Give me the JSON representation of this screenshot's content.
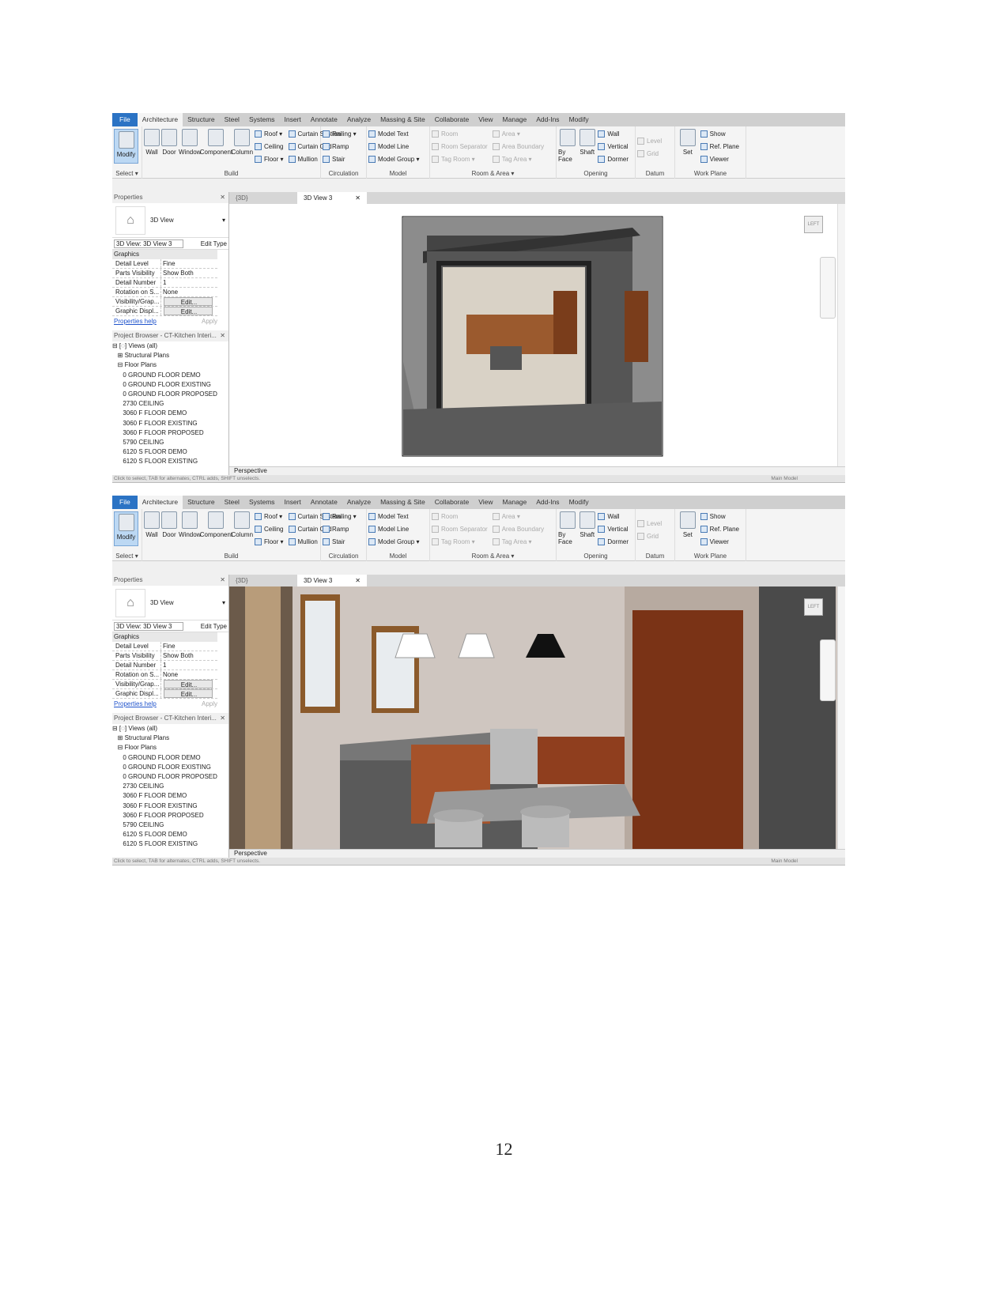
{
  "ribbon": {
    "tabs": [
      "File",
      "Architecture",
      "Structure",
      "Steel",
      "Systems",
      "Insert",
      "Annotate",
      "Analyze",
      "Massing & Site",
      "Collaborate",
      "View",
      "Manage",
      "Add-Ins",
      "Modify"
    ],
    "active_tab": "Architecture",
    "select": {
      "modify": "Modify",
      "label": "Select ▾"
    },
    "build": {
      "label": "Build",
      "big": [
        "Wall",
        "Door",
        "Window",
        "Component",
        "Column"
      ],
      "col1": [
        "Roof ▾",
        "Ceiling",
        "Floor ▾"
      ],
      "col2": [
        "Curtain System",
        "Curtain Grid",
        "Mullion"
      ]
    },
    "circulation": {
      "label": "Circulation",
      "items": [
        "Railing ▾",
        "Ramp",
        "Stair"
      ]
    },
    "model": {
      "label": "Model",
      "items": [
        "Model Text",
        "Model Line",
        "Model Group ▾"
      ]
    },
    "room_area": {
      "label": "Room & Area ▾",
      "col1": [
        "Room",
        "Room Separator",
        "Tag Room ▾"
      ],
      "col2": [
        "Area ▾",
        "Area Boundary",
        "Tag Area ▾"
      ]
    },
    "opening": {
      "label": "Opening",
      "big": [
        "By Face",
        "Shaft"
      ],
      "items": [
        "Wall",
        "Vertical",
        "Dormer"
      ]
    },
    "datum": {
      "label": "Datum",
      "items": [
        "Level",
        "Grid"
      ]
    },
    "work_plane": {
      "label": "Work Plane",
      "big": "Set",
      "items": [
        "Show",
        "Ref. Plane",
        "Viewer"
      ]
    }
  },
  "properties": {
    "title": "Properties",
    "type": "3D View",
    "selector": "3D View: 3D View 3",
    "edit_type": "Edit Type",
    "group": "Graphics",
    "rows": [
      {
        "k": "Detail Level",
        "v": "Fine"
      },
      {
        "k": "Parts Visibility",
        "v": "Show Both"
      },
      {
        "k": "Detail Number",
        "v": "1"
      },
      {
        "k": "Rotation on S...",
        "v": "None"
      },
      {
        "k": "Visibility/Grap...",
        "v": "Edit..."
      },
      {
        "k": "Graphic Displ...",
        "v": "Edit..."
      }
    ],
    "help": "Properties help",
    "apply": "Apply"
  },
  "browser": {
    "title": "Project Browser - CT-Kitchen Interi...",
    "items": [
      "⊟ [◌] Views (all)",
      "   ⊞ Structural Plans",
      "   ⊟ Floor Plans",
      "      0 GROUND FLOOR DEMO",
      "      0 GROUND FLOOR EXISTING",
      "      0 GROUND FLOOR PROPOSED",
      "      2730 CEILING",
      "      3060 F FLOOR DEMO",
      "      3060 F FLOOR EXISTING",
      "      3060 F FLOOR PROPOSED",
      "      5790 CEILING",
      "      6120 S FLOOR DEMO",
      "      6120 S FLOOR EXISTING"
    ]
  },
  "views": {
    "tab1": "{3D}",
    "tab2": "3D View 3",
    "close": "✕",
    "bar": "Perspective",
    "viewcube": "LEFT"
  },
  "status": {
    "text": "Click to select, TAB for alternates, CTRL adds, SHIFT unselects.",
    "model": "Main Model"
  },
  "page_number": "12"
}
